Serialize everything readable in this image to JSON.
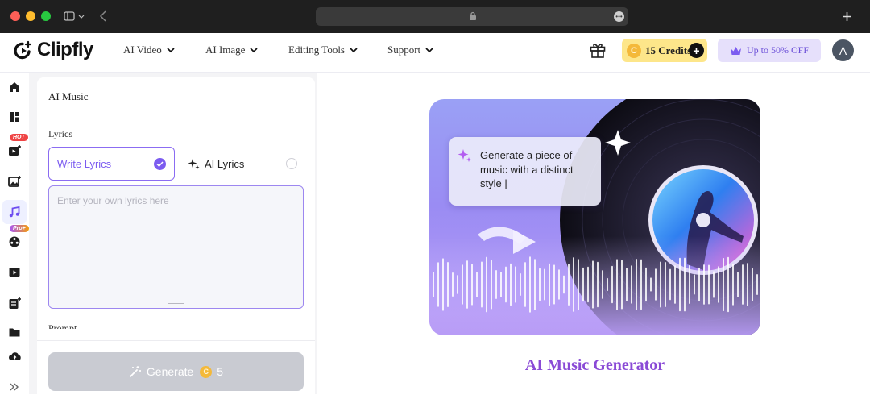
{
  "browser": {
    "colors": {
      "close": "#ff5f57",
      "minimize": "#febc2e",
      "maximize": "#28c840"
    }
  },
  "brand": {
    "name": "Clipfly"
  },
  "nav": {
    "menus": [
      {
        "label": "AI Video"
      },
      {
        "label": "AI Image"
      },
      {
        "label": "Editing Tools"
      },
      {
        "label": "Support"
      }
    ],
    "credits": {
      "coin": "C",
      "label": "15 Credits"
    },
    "offer": {
      "label": "Up to 50% OFF"
    },
    "avatar": "A"
  },
  "sidebar": {
    "items": [
      {
        "icon": "home-icon"
      },
      {
        "icon": "dashboard-icon"
      },
      {
        "icon": "video-plus-icon",
        "badge": "HOT"
      },
      {
        "icon": "image-plus-icon"
      },
      {
        "icon": "music-icon",
        "active": true
      },
      {
        "icon": "reel-icon",
        "badge": "Pro+"
      },
      {
        "icon": "play-icon"
      },
      {
        "icon": "document-plus-icon"
      },
      {
        "icon": "folder-icon"
      },
      {
        "icon": "cloud-icon"
      },
      {
        "icon": "expand-icon"
      }
    ]
  },
  "panel": {
    "title": "AI Music",
    "lyrics_label": "Lyrics",
    "options": [
      {
        "label": "Write Lyrics",
        "selected": true
      },
      {
        "label": "AI Lyrics",
        "selected": false
      }
    ],
    "placeholder": "Enter your own lyrics here",
    "next_label": "Prompt",
    "generate": {
      "label": "Generate",
      "coin": "C",
      "cost": "5"
    }
  },
  "hero": {
    "prompt_text": "Generate a piece of music with a distinct style |",
    "title": "AI Music Generator"
  },
  "colors": {
    "accent": "#7c5cf0",
    "credits_bg": "#fde68a",
    "offer_bg": "#e6e0fb",
    "hero_gradient": "#9a8cf3"
  }
}
